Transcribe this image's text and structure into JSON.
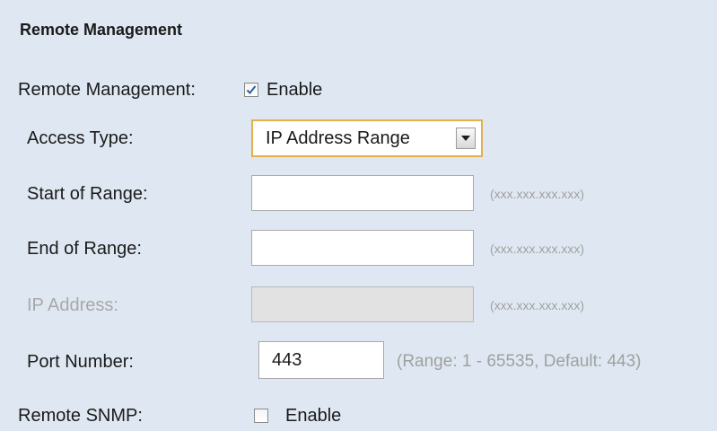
{
  "section": {
    "title": "Remote Management"
  },
  "remote_management": {
    "label": "Remote Management:",
    "checked": true,
    "option_label": "Enable"
  },
  "access_type": {
    "label": "Access Type:",
    "selected": "IP Address Range"
  },
  "start_of_range": {
    "label": "Start of Range:",
    "value": "",
    "hint": "(xxx.xxx.xxx.xxx)"
  },
  "end_of_range": {
    "label": "End of Range:",
    "value": "",
    "hint": "(xxx.xxx.xxx.xxx)"
  },
  "ip_address": {
    "label": "IP Address:",
    "value": "",
    "hint": "(xxx.xxx.xxx.xxx)",
    "disabled": true
  },
  "port_number": {
    "label": "Port Number:",
    "value": "443",
    "hint": "(Range: 1 - 65535, Default: 443)"
  },
  "remote_snmp": {
    "label": "Remote SNMP:",
    "checked": false,
    "option_label": "Enable"
  },
  "colors": {
    "panel_bg": "#dfe8f2",
    "select_focus_border": "#e3b04a",
    "check_mark": "#2f5e9e",
    "disabled_field_bg": "#e2e2e2",
    "hint_text": "#a0a0a0"
  }
}
